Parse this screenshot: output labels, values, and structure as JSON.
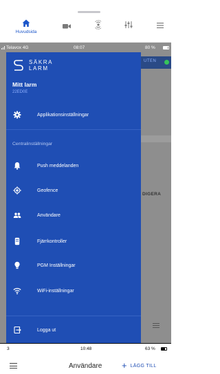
{
  "tabbar": {
    "home_label": "Huvudsida",
    "icons": [
      "home-icon",
      "camera-icon",
      "remote-icon",
      "sliders-icon",
      "menu-icon"
    ],
    "accent": "#1a55c9"
  },
  "status": {
    "carrier": "Telavox 4G",
    "time": "08:07",
    "battery": "80 %"
  },
  "background": {
    "pill": "UTEN",
    "word": "DIGERA"
  },
  "drawer": {
    "color": "#1f4eb4",
    "brand_line1": "SÄKRA",
    "brand_line2": "LARM",
    "account_name": "Mitt larm",
    "account_id": "22ED0E",
    "app_settings": "Applikationsinställningar",
    "section_title": "Centralinställningar",
    "items": [
      {
        "label": "Push meddelanden",
        "icon": "bell-icon"
      },
      {
        "label": "Geofence",
        "icon": "location-icon"
      },
      {
        "label": "Användare",
        "icon": "users-icon"
      },
      {
        "label": "Fjärrkontroller",
        "icon": "remote-control-icon"
      },
      {
        "label": "PGM Inställningar",
        "icon": "bulb-icon"
      },
      {
        "label": "WiFi-inställningar",
        "icon": "wifi-icon"
      }
    ],
    "logout": "Logga ut"
  },
  "bottom": {
    "carrier": "3",
    "time": "10:48",
    "battery": "63 %",
    "title": "Användare",
    "add_label": "LÄGG TILL"
  }
}
